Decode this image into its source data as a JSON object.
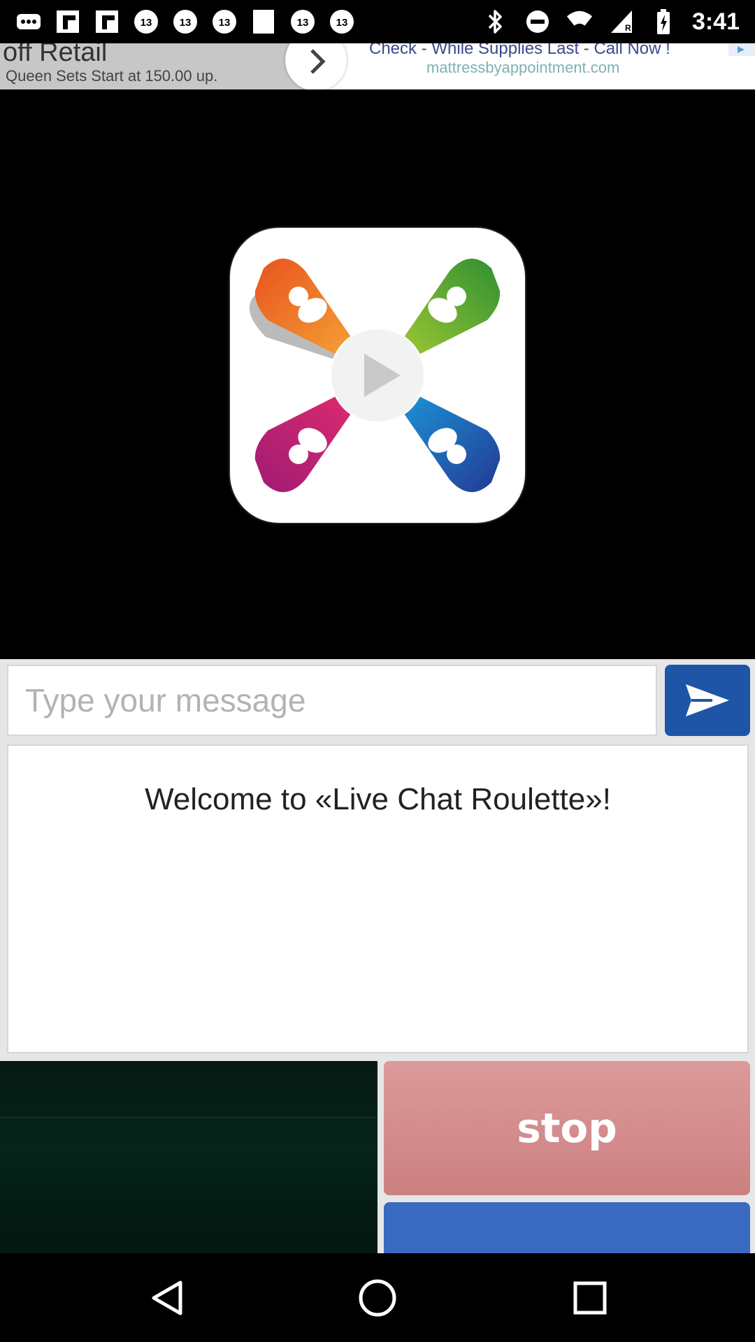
{
  "status_bar": {
    "time": "3:41",
    "left_icons": [
      "more-icon",
      "flipboard-icon",
      "flipboard-icon",
      "abc13-icon",
      "abc13-icon",
      "abc13-icon",
      "blank-notification-icon",
      "abc13-icon",
      "abc13-icon"
    ],
    "right_icons": [
      "bluetooth-icon",
      "do-not-disturb-icon",
      "wifi-icon",
      "signal-icon",
      "battery-icon"
    ]
  },
  "ad": {
    "headline": "off Retail",
    "subline": "Queen Sets Start at 150.00 up.",
    "right_title": "Check - While Supplies Last - Call Now !",
    "url": "mattressbyappointment.com"
  },
  "chat": {
    "input_placeholder": "Type your message",
    "input_value": "",
    "welcome": "Welcome to «Live Chat Roulette»!"
  },
  "controls": {
    "stop_label": "stop",
    "next_label": ""
  },
  "colors": {
    "send_button": "#1f55a6",
    "stop_button": "#d08888",
    "next_button": "#3a6abf"
  }
}
